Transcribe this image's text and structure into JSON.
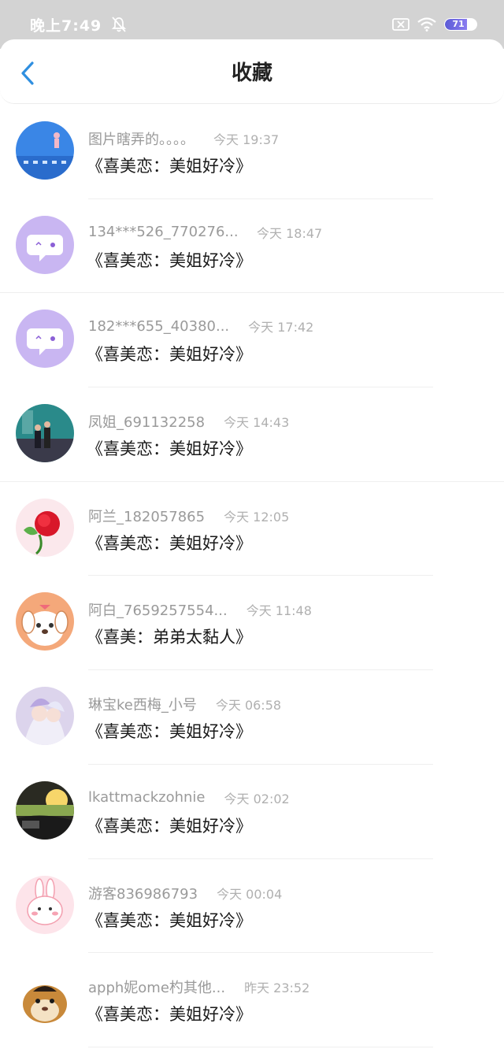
{
  "status_bar": {
    "time": "晚上7:49",
    "battery": "71"
  },
  "nav": {
    "title": "收藏"
  },
  "favorites": [
    {
      "user": "图片瞎弄的。。。。",
      "time": "今天 19:37",
      "title": "《喜美恋：美姐好冷》"
    },
    {
      "user": "134***526_770276...",
      "time": "今天 18:47",
      "title": "《喜美恋：美姐好冷》"
    },
    {
      "user": "182***655_40380...",
      "time": "今天 17:42",
      "title": "《喜美恋：美姐好冷》"
    },
    {
      "user": "凤姐_691132258",
      "time": "今天 14:43",
      "title": "《喜美恋：美姐好冷》"
    },
    {
      "user": "阿兰_182057865",
      "time": "今天 12:05",
      "title": "《喜美恋：美姐好冷》"
    },
    {
      "user": "阿白_7659257554...",
      "time": "今天 11:48",
      "title": "《喜美：弟弟太黏人》"
    },
    {
      "user": "琳宝ke西梅_小号",
      "time": "今天 06:58",
      "title": "《喜美恋：美姐好冷》"
    },
    {
      "user": "lkattmackzohnie",
      "time": "今天 02:02",
      "title": "《喜美恋：美姐好冷》"
    },
    {
      "user": "游客836986793",
      "time": "今天 00:04",
      "title": "《喜美恋：美姐好冷》"
    },
    {
      "user": "apph妮ome杓其他...",
      "time": "昨天 23:52",
      "title": "《喜美恋：美姐好冷》"
    }
  ],
  "colors": {
    "accent": "#2f8fe0",
    "avatar_purple": "#c9b6f2"
  }
}
